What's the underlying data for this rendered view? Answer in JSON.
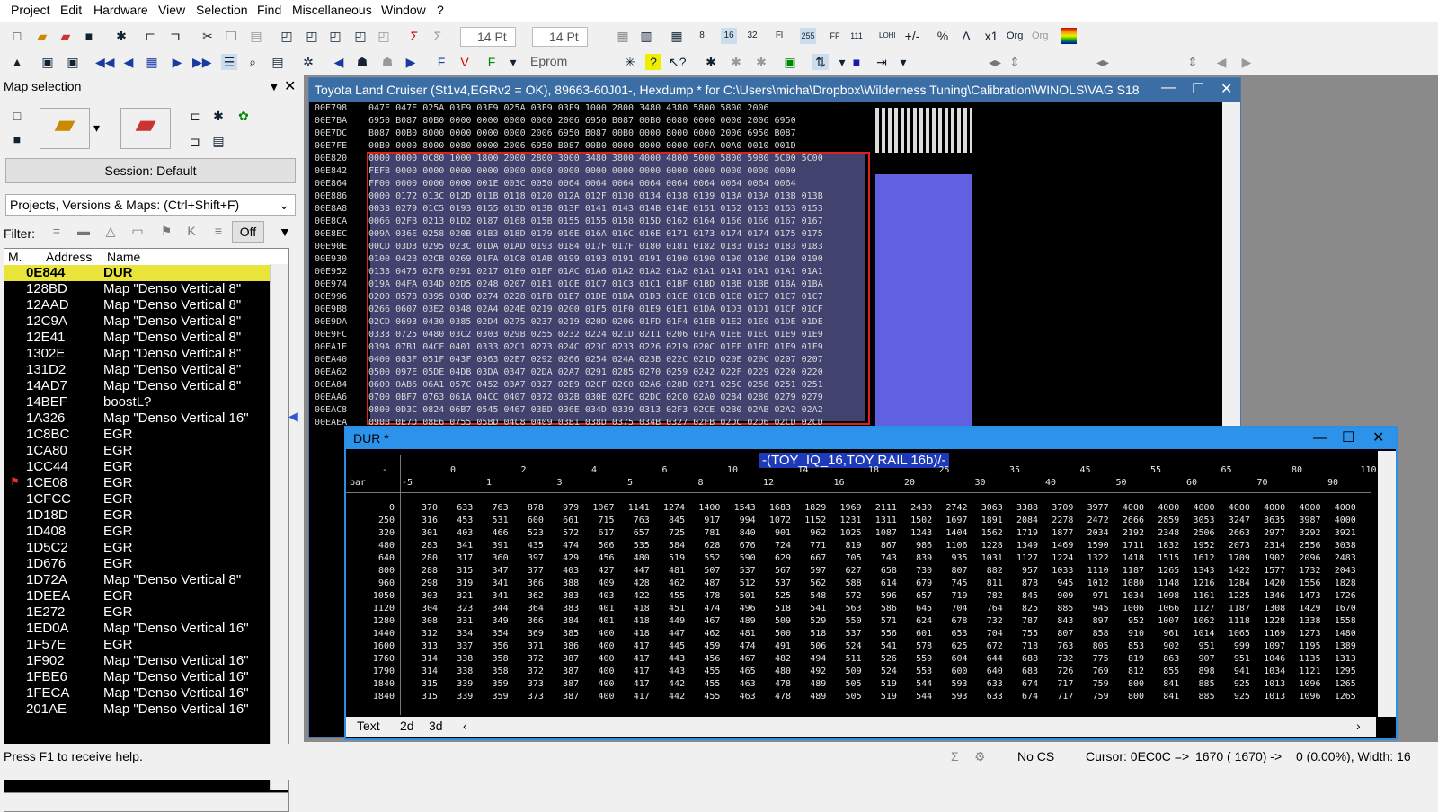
{
  "menu": [
    "Project",
    "Edit",
    "Hardware",
    "View",
    "Selection",
    "Find",
    "Miscellaneous",
    "Window",
    "?"
  ],
  "toolbar": {
    "font_size_1": "14 Pt",
    "font_size_2": "14 Pt",
    "mode": "Eprom"
  },
  "left_panel": {
    "title": "Map selection",
    "session": "Session: Default",
    "projects_combo": "Projects, Versions & Maps:  (Ctrl+Shift+F)",
    "filter_label": "Filter:",
    "off_label": "Off",
    "columns": [
      "M.",
      "Address",
      "Name"
    ],
    "rows": [
      {
        "address": "0E844",
        "name": "DUR",
        "selected": true
      },
      {
        "address": "128BD",
        "name": "Map \"Denso Vertical 8\""
      },
      {
        "address": "12AAD",
        "name": "Map \"Denso Vertical 8\""
      },
      {
        "address": "12C9A",
        "name": "Map \"Denso Vertical 8\""
      },
      {
        "address": "12E41",
        "name": "Map \"Denso Vertical 8\""
      },
      {
        "address": "1302E",
        "name": "Map \"Denso Vertical 8\""
      },
      {
        "address": "131D2",
        "name": "Map \"Denso Vertical 8\""
      },
      {
        "address": "14AD7",
        "name": "Map \"Denso Vertical 8\""
      },
      {
        "address": "14BEF",
        "name": "boostL?"
      },
      {
        "address": "1A326",
        "name": "Map \"Denso Vertical 16\""
      },
      {
        "address": "1C8BC",
        "name": "EGR"
      },
      {
        "address": "1CA80",
        "name": "EGR"
      },
      {
        "address": "1CC44",
        "name": "EGR"
      },
      {
        "address": "1CE08",
        "name": "EGR",
        "flag": true
      },
      {
        "address": "1CFCC",
        "name": "EGR"
      },
      {
        "address": "1D18D",
        "name": "EGR"
      },
      {
        "address": "1D408",
        "name": "EGR"
      },
      {
        "address": "1D5C2",
        "name": "EGR"
      },
      {
        "address": "1D676",
        "name": "EGR"
      },
      {
        "address": "1D72A",
        "name": "Map \"Denso Vertical 8\""
      },
      {
        "address": "1DEEA",
        "name": "EGR"
      },
      {
        "address": "1E272",
        "name": "EGR"
      },
      {
        "address": "1ED0A",
        "name": "Map \"Denso Vertical 16\""
      },
      {
        "address": "1F57E",
        "name": "EGR"
      },
      {
        "address": "1F902",
        "name": "Map \"Denso Vertical 16\""
      },
      {
        "address": "1FBE6",
        "name": "Map \"Denso Vertical 16\""
      },
      {
        "address": "1FECA",
        "name": "Map \"Denso Vertical 16\""
      },
      {
        "address": "201AE",
        "name": "Map \"Denso Vertical 16\""
      }
    ]
  },
  "hex_window": {
    "title": "Toyota Land Cruiser (St1v4,EGRv2 = OK), 89663-60J01-, Hexdump * for C:\\Users\\micha\\Dropbox\\Wilderness Tuning\\Calibration\\WINOLS\\VAG S18",
    "rows": [
      {
        "addr": "00E798",
        "cells": "047E 047E 025A 03F9 03F9 025A 03F9 03F9 1000 2800 3480 4380 5800 5800 2006"
      },
      {
        "addr": "00E7BA",
        "cells": "6950 B087 80B0 0000 0000 0000 0000 2006 6950 B087 00B0 0080 0000 0000 2006 6950"
      },
      {
        "addr": "00E7DC",
        "cells": "B087 00B0 8000 0000 0000 0000 2006 6950 B087 00B0 0000 8000 0000 2006 6950 B087"
      },
      {
        "addr": "00E7FE",
        "cells": "00B0 0000 8000 0080 0000 2006 6950 B087 00B0 0000 0000 0000 00FA 00A0 0010 001D"
      },
      {
        "addr": "00E820",
        "cells": "0000 0000 0C80 1000 1800 2000 2800 3000 3480 3800 4000 4800 5000 5800 5980 5C00 5C00"
      },
      {
        "addr": "00E842",
        "cells": "FEFB 0000 0000 0000 0000 0000 0000 0000 0000 0000 0000 0000 0000 0000 0000 0000"
      },
      {
        "addr": "00E864",
        "cells": "FF00 0000 0000 0000 001E 003C 0050 0064 0064 0064 0064 0064 0064 0064 0064 0064"
      },
      {
        "addr": "00E886",
        "cells": "0000 0172 013C 012D 011B 0118 0120 012A 012F 0130 0134 0138 0139 013A 013A 013B 013B"
      },
      {
        "addr": "00E8A8",
        "cells": "0033 0279 01C5 0193 0155 013D 013B 013F 0141 0143 014B 014E 0151 0152 0153 0153 0153"
      },
      {
        "addr": "00E8CA",
        "cells": "0066 02FB 0213 01D2 0187 0168 015B 0155 0155 0158 015D 0162 0164 0166 0166 0167 0167"
      },
      {
        "addr": "00E8EC",
        "cells": "009A 036E 0258 020B 01B3 018D 0179 016E 016A 016C 016E 0171 0173 0174 0174 0175 0175"
      },
      {
        "addr": "00E90E",
        "cells": "00CD 03D3 0295 023C 01DA 01AD 0193 0184 017F 017F 0180 0181 0182 0183 0183 0183 0183"
      },
      {
        "addr": "00E930",
        "cells": "0100 042B 02CB 0269 01FA 01C8 01AB 0199 0193 0191 0191 0190 0190 0190 0190 0190 0190"
      },
      {
        "addr": "00E952",
        "cells": "0133 0475 02F8 0291 0217 01E0 01BF 01AC 01A6 01A2 01A2 01A2 01A1 01A1 01A1 01A1 01A1"
      },
      {
        "addr": "00E974",
        "cells": "019A 04FA 034D 02D5 0248 0207 01E1 01CE 01C7 01C3 01C1 01BF 01BD 01BB 01BB 01BA 01BA"
      },
      {
        "addr": "00E996",
        "cells": "0200 0578 0395 030D 0274 0228 01FB 01E7 01DE 01DA 01D3 01CE 01CB 01C8 01C7 01C7 01C7"
      },
      {
        "addr": "00E9B8",
        "cells": "0266 0607 03E2 0348 02A4 024E 0219 0200 01F5 01F0 01E9 01E1 01DA 01D3 01D1 01CF 01CF"
      },
      {
        "addr": "00E9DA",
        "cells": "02CD 0693 0430 0385 02D4 0275 0237 0219 020D 0206 01FD 01F4 01EB 01E2 01E0 01DE 01DE"
      },
      {
        "addr": "00E9FC",
        "cells": "0333 0725 0480 03C2 0303 029B 0255 0232 0224 021D 0211 0206 01FA 01EE 01EC 01E9 01E9"
      },
      {
        "addr": "00EA1E",
        "cells": "039A 07B1 04CF 0401 0333 02C1 0273 024C 023C 0233 0226 0219 020C 01FF 01FD 01F9 01F9"
      },
      {
        "addr": "00EA40",
        "cells": "0400 083F 051F 043F 0363 02E7 0292 0266 0254 024A 023B 022C 021D 020E 020C 0207 0207"
      },
      {
        "addr": "00EA62",
        "cells": "0500 097E 05DE 04DB 03DA 0347 02DA 02A7 0291 0285 0270 0259 0242 022F 0229 0220 0220"
      },
      {
        "addr": "00EA84",
        "cells": "0600 0AB6 06A1 057C 0452 03A7 0327 02E9 02CF 02C0 02A6 028D 0271 025C 0258 0251 0251"
      },
      {
        "addr": "00EAA6",
        "cells": "0700 0BF7 0763 061A 04CC 0407 0372 032B 030E 02FC 02DC 02C0 02A0 0284 0280 0279 0279"
      },
      {
        "addr": "00EAC8",
        "cells": "0800 0D3C 0824 06B7 0545 0467 03BD 036E 034D 0339 0313 02F3 02CE 02B0 02AB 02A2 02A2"
      },
      {
        "addr": "00EAEA",
        "cells": "0900 0E7D 08E6 0755 05BD 04C8 0409 03B1 038D 0375 034B 0327 02FB 02DC 02D6 02CD 02CD"
      }
    ]
  },
  "dur_window": {
    "title": "DUR *",
    "badge": "-(TOY_IQ_16,TOY RAIL 16b)/-",
    "row_header": "bar",
    "corner": "-",
    "col_top": [
      "0",
      "2",
      "4",
      "6",
      "10",
      "14",
      "18",
      "25",
      "35",
      "45",
      "55",
      "65",
      "80",
      "110"
    ],
    "col_mid": [
      "1",
      "3",
      "5",
      "8",
      "12",
      "16",
      "20",
      "30",
      "40",
      "50",
      "60",
      "70",
      "90"
    ],
    "col_first": "-5",
    "rows": [
      {
        "h": "0",
        "v": [
          "370",
          "633",
          "763",
          "878",
          "979",
          "1067",
          "1141",
          "1274",
          "1400",
          "1543",
          "1683",
          "1829",
          "1969",
          "2111",
          "2430",
          "2742",
          "3063",
          "3388",
          "3709",
          "3977",
          "4000",
          "4000",
          "4000",
          "4000",
          "4000",
          "4000",
          "4000"
        ]
      },
      {
        "h": "250",
        "v": [
          "316",
          "453",
          "531",
          "600",
          "661",
          "715",
          "763",
          "845",
          "917",
          "994",
          "1072",
          "1152",
          "1231",
          "1311",
          "1502",
          "1697",
          "1891",
          "2084",
          "2278",
          "2472",
          "2666",
          "2859",
          "3053",
          "3247",
          "3635",
          "3987",
          "4000"
        ]
      },
      {
        "h": "320",
        "v": [
          "301",
          "403",
          "466",
          "523",
          "572",
          "617",
          "657",
          "725",
          "781",
          "840",
          "901",
          "962",
          "1025",
          "1087",
          "1243",
          "1404",
          "1562",
          "1719",
          "1877",
          "2034",
          "2192",
          "2348",
          "2506",
          "2663",
          "2977",
          "3292",
          "3921"
        ]
      },
      {
        "h": "480",
        "v": [
          "283",
          "341",
          "391",
          "435",
          "474",
          "506",
          "535",
          "584",
          "628",
          "676",
          "724",
          "771",
          "819",
          "867",
          "986",
          "1106",
          "1228",
          "1349",
          "1469",
          "1590",
          "1711",
          "1832",
          "1952",
          "2073",
          "2314",
          "2556",
          "3038"
        ]
      },
      {
        "h": "640",
        "v": [
          "280",
          "317",
          "360",
          "397",
          "429",
          "456",
          "480",
          "519",
          "552",
          "590",
          "629",
          "667",
          "705",
          "743",
          "839",
          "935",
          "1031",
          "1127",
          "1224",
          "1322",
          "1418",
          "1515",
          "1612",
          "1709",
          "1902",
          "2096",
          "2483"
        ]
      },
      {
        "h": "800",
        "v": [
          "288",
          "315",
          "347",
          "377",
          "403",
          "427",
          "447",
          "481",
          "507",
          "537",
          "567",
          "597",
          "627",
          "658",
          "730",
          "807",
          "882",
          "957",
          "1033",
          "1110",
          "1187",
          "1265",
          "1343",
          "1422",
          "1577",
          "1732",
          "2043"
        ]
      },
      {
        "h": "960",
        "v": [
          "298",
          "319",
          "341",
          "366",
          "388",
          "409",
          "428",
          "462",
          "487",
          "512",
          "537",
          "562",
          "588",
          "614",
          "679",
          "745",
          "811",
          "878",
          "945",
          "1012",
          "1080",
          "1148",
          "1216",
          "1284",
          "1420",
          "1556",
          "1828"
        ]
      },
      {
        "h": "1050",
        "v": [
          "303",
          "321",
          "341",
          "362",
          "383",
          "403",
          "422",
          "455",
          "478",
          "501",
          "525",
          "548",
          "572",
          "596",
          "657",
          "719",
          "782",
          "845",
          "909",
          "971",
          "1034",
          "1098",
          "1161",
          "1225",
          "1346",
          "1473",
          "1726"
        ]
      },
      {
        "h": "1120",
        "v": [
          "304",
          "323",
          "344",
          "364",
          "383",
          "401",
          "418",
          "451",
          "474",
          "496",
          "518",
          "541",
          "563",
          "586",
          "645",
          "704",
          "764",
          "825",
          "885",
          "945",
          "1006",
          "1066",
          "1127",
          "1187",
          "1308",
          "1429",
          "1670"
        ]
      },
      {
        "h": "1280",
        "v": [
          "308",
          "331",
          "349",
          "366",
          "384",
          "401",
          "418",
          "449",
          "467",
          "489",
          "509",
          "529",
          "550",
          "571",
          "624",
          "678",
          "732",
          "787",
          "843",
          "897",
          "952",
          "1007",
          "1062",
          "1118",
          "1228",
          "1338",
          "1558"
        ]
      },
      {
        "h": "1440",
        "v": [
          "312",
          "334",
          "354",
          "369",
          "385",
          "400",
          "418",
          "447",
          "462",
          "481",
          "500",
          "518",
          "537",
          "556",
          "601",
          "653",
          "704",
          "755",
          "807",
          "858",
          "910",
          "961",
          "1014",
          "1065",
          "1169",
          "1273",
          "1480"
        ]
      },
      {
        "h": "1600",
        "v": [
          "313",
          "337",
          "356",
          "371",
          "386",
          "400",
          "417",
          "445",
          "459",
          "474",
          "491",
          "506",
          "524",
          "541",
          "578",
          "625",
          "672",
          "718",
          "763",
          "805",
          "853",
          "902",
          "951",
          "999",
          "1097",
          "1195",
          "1389"
        ]
      },
      {
        "h": "1760",
        "v": [
          "314",
          "338",
          "358",
          "372",
          "387",
          "400",
          "417",
          "443",
          "456",
          "467",
          "482",
          "494",
          "511",
          "526",
          "559",
          "604",
          "644",
          "688",
          "732",
          "775",
          "819",
          "863",
          "907",
          "951",
          "1046",
          "1135",
          "1313"
        ]
      },
      {
        "h": "1790",
        "v": [
          "314",
          "338",
          "358",
          "372",
          "387",
          "400",
          "417",
          "443",
          "455",
          "465",
          "480",
          "492",
          "509",
          "524",
          "553",
          "600",
          "640",
          "683",
          "726",
          "769",
          "812",
          "855",
          "898",
          "941",
          "1034",
          "1121",
          "1295"
        ]
      },
      {
        "h": "1840",
        "v": [
          "315",
          "339",
          "359",
          "373",
          "387",
          "400",
          "417",
          "442",
          "455",
          "463",
          "478",
          "489",
          "505",
          "519",
          "544",
          "593",
          "633",
          "674",
          "717",
          "759",
          "800",
          "841",
          "885",
          "925",
          "1013",
          "1096",
          "1265"
        ]
      },
      {
        "h": "1840",
        "v": [
          "315",
          "339",
          "359",
          "373",
          "387",
          "400",
          "417",
          "442",
          "455",
          "463",
          "478",
          "489",
          "505",
          "519",
          "544",
          "593",
          "633",
          "674",
          "717",
          "759",
          "800",
          "841",
          "885",
          "925",
          "1013",
          "1096",
          "1265"
        ]
      }
    ],
    "tabs": [
      "Text",
      "2d",
      "3d"
    ],
    "back_tab": "Text"
  },
  "status": {
    "help": "Press F1 to receive help.",
    "cs": "No CS",
    "cursor": "Cursor: 0EC0C => ",
    "value": "1670 ( 1670) ->",
    "width": "0 (0.00%), Width: 16"
  },
  "colors": {
    "selected_row": "#e8e43a",
    "hex_title": "#3c6ea6",
    "dur_title": "#2d93ea",
    "badge": "#1e3ab8",
    "graph": "#6060e0",
    "selection_box": "#e02020"
  }
}
